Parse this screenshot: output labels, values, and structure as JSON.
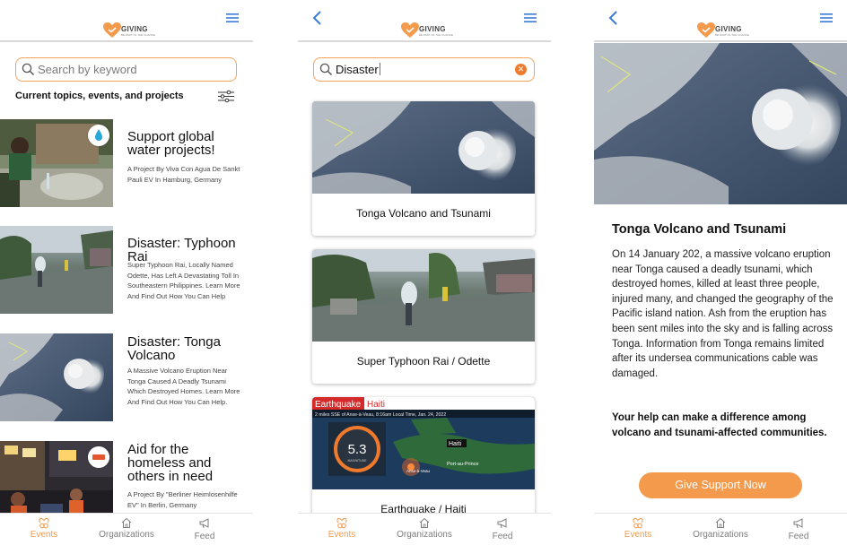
{
  "colors": {
    "accent": "#f39a4c",
    "search_border": "#f5a25a",
    "link_blue": "#3a7bd5"
  },
  "brand": {
    "name": "GIVING",
    "tagline": "BE PART OF THE CHANGE"
  },
  "nav": {
    "events": "Events",
    "organizations": "Organizations",
    "feed": "Feed"
  },
  "home": {
    "search_placeholder": "Search by keyword",
    "topics_heading": "Current topics, events, and projects",
    "items": [
      {
        "title": "Support global water projects!",
        "description": "A Project By Viva Con Agua De Sankt Pauli EV In Hamburg, Germany"
      },
      {
        "title": "Disaster: Typhoon Rai",
        "description": "Super Typhoon Rai, Locally Named Odette, Has Left A Devastating Toll In Southeastern Philippines. Learn More And Find Out How You Can Help"
      },
      {
        "title": "Disaster: Tonga Volcano",
        "description": "A Massive Volcano Eruption Near Tonga Caused A Deadly Tsunami Which Destroyed Homes. Learn More And Find Out How You Can Help."
      },
      {
        "title": "Aid for the homeless and others in need",
        "description": "A Project By \"Berliner Heimlosenhilfe EV\" In Berlin, Germany"
      }
    ]
  },
  "search_results": {
    "query": "Disaster",
    "cards": [
      {
        "caption": "Tonga Volcano and Tsunami"
      },
      {
        "caption": "Super Typhoon Rai / Odette"
      },
      {
        "caption": "Earthquake / Haiti",
        "banner_left": "Earthquake",
        "banner_right": "Haiti",
        "ticker": "2 miles SSE of Anse-à-Veau, 8:16am Local Time, Jan. 24, 2022",
        "magnitude": "5.3",
        "magnitude_label": "MAGNITUDE",
        "map_labels": [
          "Haiti",
          "Port-au-Prince",
          "Anse-à-Veau"
        ]
      }
    ]
  },
  "detail": {
    "title": "Tonga Volcano and Tsunami",
    "body": "On 14 January 202, a massive volcano eruption near Tonga caused a deadly tsunami, which destroyed homes, killed at least three people, injured many, and changed the geography of the Pacific island nation. Ash from the eruption has been sent miles into the sky and is falling across Tonga. Information from Tonga remains limited after its undersea communications cable was damaged.",
    "cta": "Your help can make a difference among volcano and tsunami-affected communities.",
    "button": "Give Support Now"
  }
}
